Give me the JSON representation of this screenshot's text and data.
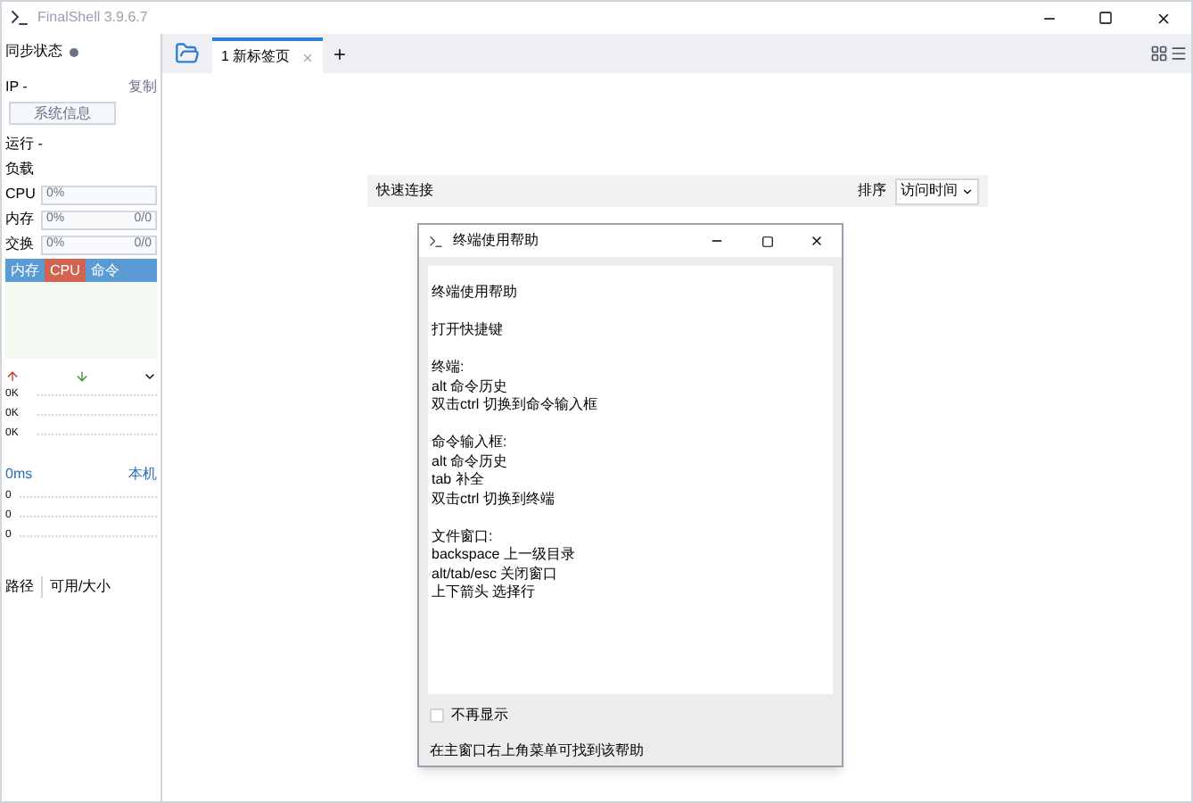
{
  "window": {
    "title": "FinalShell 3.9.6.7"
  },
  "sidebar": {
    "sync_label": "同步状态",
    "ip_label": "IP -",
    "copy_link": "复制",
    "sysinfo_button": "系统信息",
    "uptime": "运行 -",
    "load": "负载",
    "meters": [
      {
        "label": "CPU",
        "reading": "0%"
      },
      {
        "label": "内存",
        "reading": "0%",
        "extra": "0/0"
      },
      {
        "label": "交换",
        "reading": "0%",
        "extra": "0/0"
      }
    ],
    "process_columns": [
      {
        "label": "内存",
        "selected": false
      },
      {
        "label": "CPU",
        "selected": true
      },
      {
        "label": "命令",
        "selected": false
      }
    ],
    "net_rows": [
      "0K",
      "0K",
      "0K"
    ],
    "ping": "0ms",
    "host": "本机",
    "ping_rows": [
      "0",
      "0",
      "0"
    ],
    "disk_columns": [
      "路径",
      "可用/大小"
    ]
  },
  "tabs": [
    {
      "label": "1 新标签页",
      "selected": true
    }
  ],
  "quick_connect": {
    "label": "快速连接",
    "sort_label": "排序",
    "sort_value": "访问时间"
  },
  "dialog": {
    "title": "终端使用帮助",
    "sections": [
      [
        "终端使用帮助"
      ],
      [
        "打开快捷键"
      ],
      [
        "终端:",
        "alt 命令历史",
        "双击ctrl 切换到命令输入框"
      ],
      [
        "命令输入框:",
        "alt 命令历史",
        "tab 补全",
        "双击ctrl 切换到终端"
      ],
      [
        "文件窗口:",
        "backspace 上一级目录",
        "alt/tab/esc 关闭窗口",
        "上下箭头 选择行"
      ]
    ],
    "dont_show": {
      "label": "不再显示",
      "checked": false
    },
    "footer": "在主窗口右上角菜单可找到该帮助"
  }
}
